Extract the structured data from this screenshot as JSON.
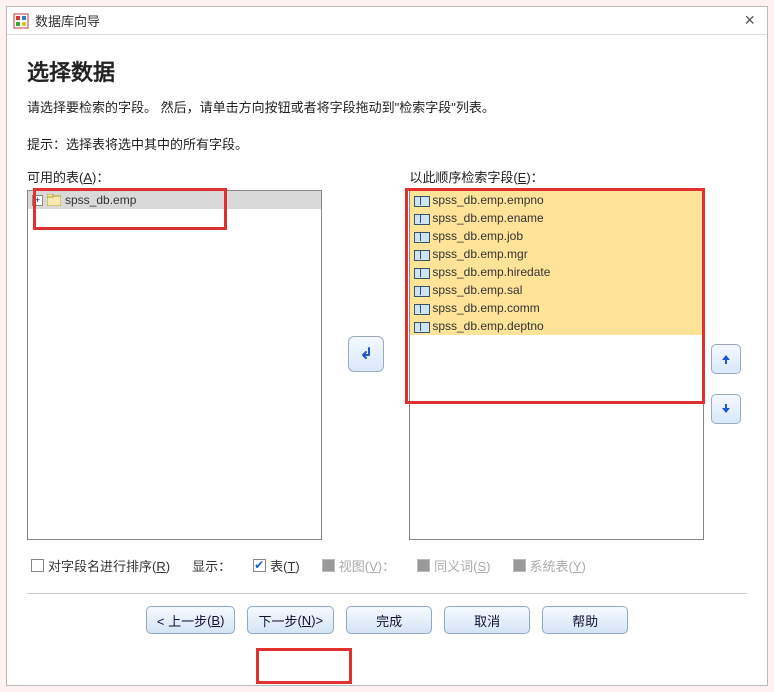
{
  "window": {
    "title": "数据库向导"
  },
  "page": {
    "heading": "选择数据",
    "description": "请选择要检索的字段。 然后，请单击方向按钮或者将字段拖动到\"检索字段\"列表。",
    "hint": "提示：选择表将选中其中的所有字段。"
  },
  "left": {
    "label_prefix": "可用的表",
    "label_mn": "A",
    "tree_root": "spss_db.emp"
  },
  "right": {
    "label_prefix": "以此顺序检索字段",
    "label_mn": "E",
    "fields": [
      "spss_db.emp.empno",
      "spss_db.emp.ename",
      "spss_db.emp.job",
      "spss_db.emp.mgr",
      "spss_db.emp.hiredate",
      "spss_db.emp.sal",
      "spss_db.emp.comm",
      "spss_db.emp.deptno"
    ]
  },
  "buttons": {
    "move": "↵",
    "up": "↑",
    "down": "↓"
  },
  "options": {
    "sort_prefix": "对字段名进行排序",
    "sort_mn": "R",
    "show_label": "显示：",
    "table_prefix": "表",
    "table_mn": "T",
    "view_prefix": "视图",
    "view_mn": "V",
    "syn_prefix": "同义词",
    "syn_mn": "S",
    "sys_prefix": "系统表",
    "sys_mn": "Y"
  },
  "wizard": {
    "back_l": "< 上一步",
    "back_mn": "B",
    "next_l": "下一步",
    "next_mn": "N",
    "next_r": " >",
    "finish": "完成",
    "cancel": "取消",
    "help": "帮助"
  }
}
